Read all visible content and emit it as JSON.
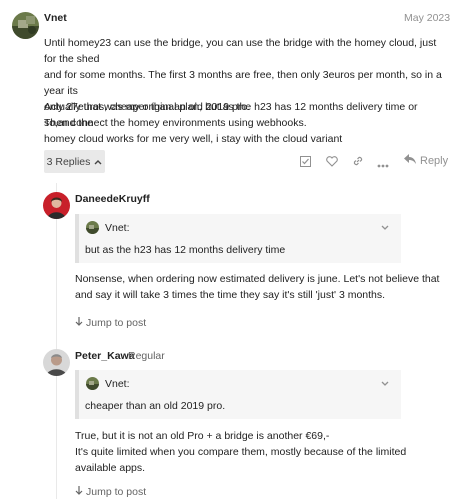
{
  "main_post": {
    "username": "Vnet",
    "date": "May 2023",
    "paragraph1_lines": [
      "Until homey23 can use the bridge, you can use the bridge with the homey cloud, just for the shed",
      "and for some months. The first 3 months are free, then only 3euros per month, so in a year its",
      "only 27euros, cheaper than an old 2019 pro.",
      "Then connect the homey environments using webhooks."
    ],
    "paragraph2_lines": [
      "Actually that was my original plan, but as the h23 has 12 months delivery time or so,and the",
      "homey cloud works for me very well, i stay with the cloud variant"
    ],
    "replies_label": "3 Replies",
    "reply_label": "Reply",
    "icons": [
      "checkbox-icon",
      "heart-icon",
      "link-icon",
      "more-icon",
      "reply-icon"
    ]
  },
  "replies": [
    {
      "username": "DaneedeKruyff",
      "quote_name": "Vnet:",
      "quote_text": "but as the h23 has 12 months delivery time",
      "body_lines": [
        "Nonsense, when ordering now estimated delivery is june. Let's not believe that",
        "and say it will take 3 times the time they say it's still 'just' 3 months."
      ],
      "jump_label": "Jump to post"
    },
    {
      "username": "Peter_Kawa",
      "user_title": "Regular",
      "quote_name": "Vnet:",
      "quote_text": "cheaper than an old 2019 pro.",
      "body_lines": [
        "True, but it is not an old Pro + a bridge is another €69,-",
        "It's quite limited when you compare them, mostly because of the limited",
        "available apps."
      ],
      "jump_label": "Jump to post"
    }
  ],
  "colors": {
    "muted": "#919191",
    "quote_bg": "#f6f6f6",
    "button_bg": "#e9e9e9"
  }
}
